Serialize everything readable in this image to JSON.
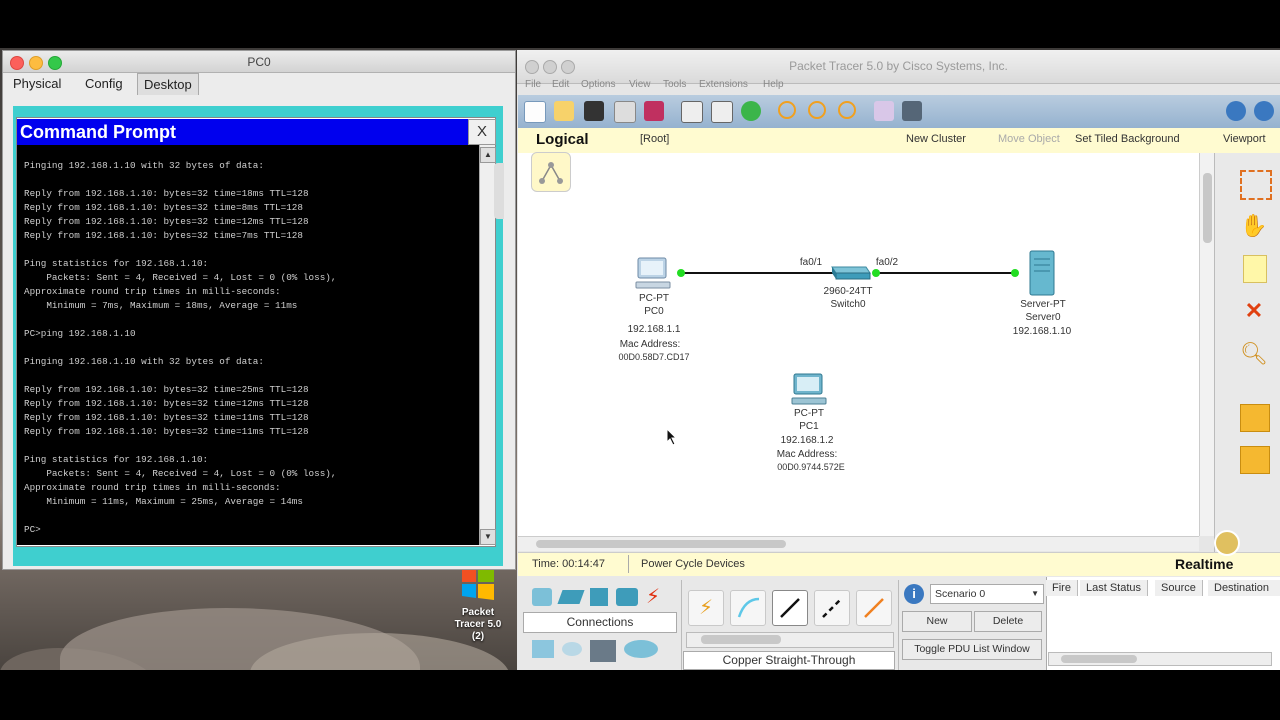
{
  "desktop": {
    "icon_label": "Packet Tracer 5.0 (2)"
  },
  "pc0_window": {
    "title": "PC0",
    "tabs": [
      "Physical",
      "Config",
      "Desktop"
    ],
    "cmd": {
      "title": "Command Prompt",
      "close": "X",
      "lines": [
        "",
        "Pinging 192.168.1.10 with 32 bytes of data:",
        "",
        "Reply from 192.168.1.10: bytes=32 time=18ms TTL=128",
        "Reply from 192.168.1.10: bytes=32 time=8ms TTL=128",
        "Reply from 192.168.1.10: bytes=32 time=12ms TTL=128",
        "Reply from 192.168.1.10: bytes=32 time=7ms TTL=128",
        "",
        "Ping statistics for 192.168.1.10:",
        "    Packets: Sent = 4, Received = 4, Lost = 0 (0% loss),",
        "Approximate round trip times in milli-seconds:",
        "    Minimum = 7ms, Maximum = 18ms, Average = 11ms",
        "",
        "PC>ping 192.168.1.10",
        "",
        "Pinging 192.168.1.10 with 32 bytes of data:",
        "",
        "Reply from 192.168.1.10: bytes=32 time=25ms TTL=128",
        "Reply from 192.168.1.10: bytes=32 time=12ms TTL=128",
        "Reply from 192.168.1.10: bytes=32 time=11ms TTL=128",
        "Reply from 192.168.1.10: bytes=32 time=11ms TTL=128",
        "",
        "Ping statistics for 192.168.1.10:",
        "    Packets: Sent = 4, Received = 4, Lost = 0 (0% loss),",
        "Approximate round trip times in milli-seconds:",
        "    Minimum = 11ms, Maximum = 25ms, Average = 14ms",
        "",
        "PC>"
      ]
    }
  },
  "pt_window": {
    "title": "Packet Tracer 5.0 by Cisco Systems, Inc.",
    "menu": [
      "File",
      "Edit",
      "Options",
      "View",
      "Tools",
      "Extensions",
      "Help"
    ],
    "logical_bar": {
      "mode": "Logical",
      "root": "[Root]",
      "new_cluster": "New Cluster",
      "move_object": "Move Object",
      "set_tiled_bg": "Set Tiled Background",
      "viewport": "Viewport"
    },
    "devices": {
      "pc0": {
        "type": "PC-PT",
        "name": "PC0",
        "ip": "192.168.1.1",
        "mac_label": "Mac Address:",
        "mac": "00D0.58D7.CD17"
      },
      "switch0": {
        "type": "2960-24TT",
        "name": "Switch0",
        "port_left": "fa0/1",
        "port_right": "fa0/2"
      },
      "server0": {
        "type": "Server-PT",
        "name": "Server0",
        "ip": "192.168.1.10"
      },
      "pc1": {
        "type": "PC-PT",
        "name": "PC1",
        "ip": "192.168.1.2",
        "mac_label": "Mac Address:",
        "mac": "00D0.9744.572E"
      }
    },
    "time_bar": {
      "time": "Time: 00:14:47",
      "power_cycle": "Power Cycle Devices",
      "mode": "Realtime"
    },
    "bottom": {
      "category_label": "Connections",
      "cable_label": "Copper Straight-Through",
      "scenario": "Scenario 0",
      "new_btn": "New",
      "delete_btn": "Delete",
      "toggle_pdu": "Toggle PDU List Window",
      "pdu_columns": [
        "Fire",
        "Last Status",
        "Source",
        "Destination"
      ]
    }
  },
  "colors": {
    "cmd_title_bg": "#0000ee",
    "cmd_frame": "#3fcfcf",
    "link_green": "#22dd22",
    "toolbar_blue": "#a8c0d8",
    "logical_bar": "#fffbd0"
  }
}
